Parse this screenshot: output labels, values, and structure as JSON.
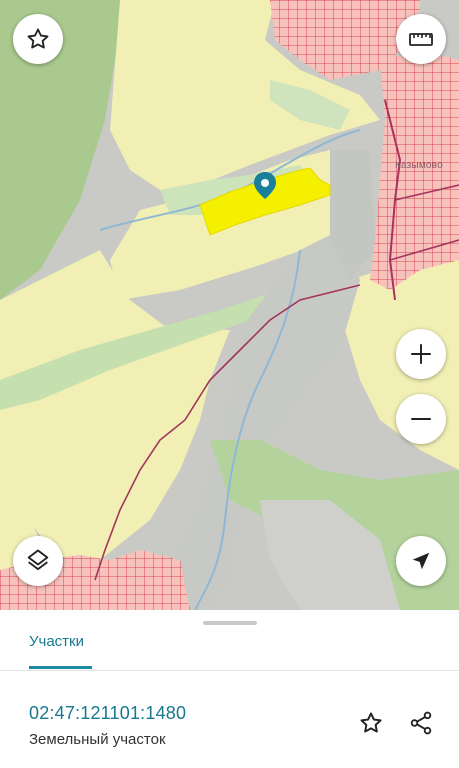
{
  "map": {
    "place_label": "Казымово",
    "icons": {
      "favorite": "star-outline-icon",
      "ruler": "ruler-icon",
      "zoom_in": "plus-icon",
      "zoom_out": "minus-icon",
      "layers": "layers-icon",
      "locate": "navigation-arrow-icon",
      "marker": "map-pin-icon"
    },
    "colors": {
      "selected_parcel": "#f5f000",
      "marker": "#1a7f9a",
      "agri_land": "#f2efb3",
      "forest": "#a8c98c",
      "settlement_parcels": "#f4b3ad"
    }
  },
  "sheet": {
    "tab_label": "Участки",
    "cadastral_number": "02:47:121101:1480",
    "object_type": "Земельный участок",
    "colors": {
      "accent": "#18788e"
    }
  }
}
